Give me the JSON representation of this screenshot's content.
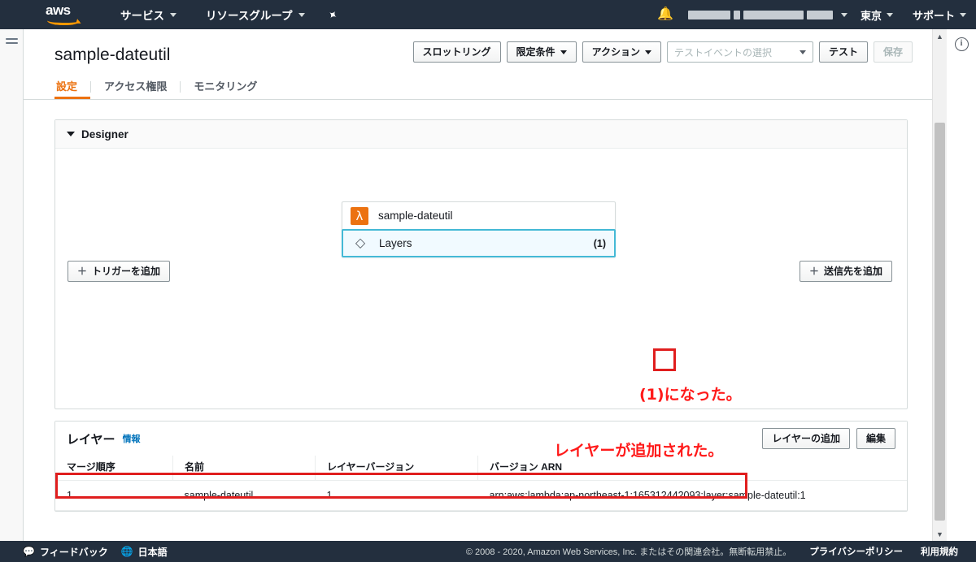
{
  "topnav": {
    "logo_text": "aws",
    "services": "サービス",
    "resource_groups": "リソースグループ",
    "pin_icon": "pin-icon",
    "bell_icon": "bell-icon",
    "account": "",
    "region": "東京",
    "support": "サポート"
  },
  "page": {
    "title": "sample-dateutil",
    "tabs": [
      {
        "label": "設定",
        "active": true
      },
      {
        "label": "アクセス権限",
        "active": false
      },
      {
        "label": "モニタリング",
        "active": false
      }
    ]
  },
  "toolbar": {
    "throttle": "スロットリング",
    "qualifiers": "限定条件",
    "actions": "アクション",
    "test_event_placeholder": "テストイベントの選択",
    "test": "テスト",
    "save": "保存"
  },
  "designer": {
    "title": "Designer",
    "function_name": "sample-dateutil",
    "layers_label": "Layers",
    "layers_count": "(1)",
    "add_trigger": "トリガーを追加",
    "add_destination": "送信先を追加",
    "plus": "＋",
    "annotation": "(1)になった。"
  },
  "layers_section": {
    "title": "レイヤー",
    "info_link": "情報",
    "add_layer": "レイヤーの追加",
    "edit": "編集",
    "annotation": "レイヤーが追加された。",
    "columns": [
      "マージ順序",
      "名前",
      "レイヤーバージョン",
      "バージョン ARN"
    ],
    "rows": [
      {
        "merge_order": "1",
        "name": "sample-dateutil",
        "layer_version": "1",
        "version_arn": "arn:aws:lambda:ap-northeast-1:165312442093:layer:sample-dateutil:1"
      }
    ]
  },
  "footer": {
    "feedback": "フィードバック",
    "language": "日本語",
    "copyright": "© 2008 - 2020, Amazon Web Services, Inc. またはその関連会社。無断転用禁止。",
    "privacy": "プライバシーポリシー",
    "terms": "利用規約"
  },
  "colors": {
    "nav_bg": "#232f3e",
    "accent": "#ec7211",
    "link": "#0073bb",
    "annotation_red": "#ff1a1a",
    "highlight_red": "#e01e1e",
    "selected_border": "#44b9d6"
  }
}
